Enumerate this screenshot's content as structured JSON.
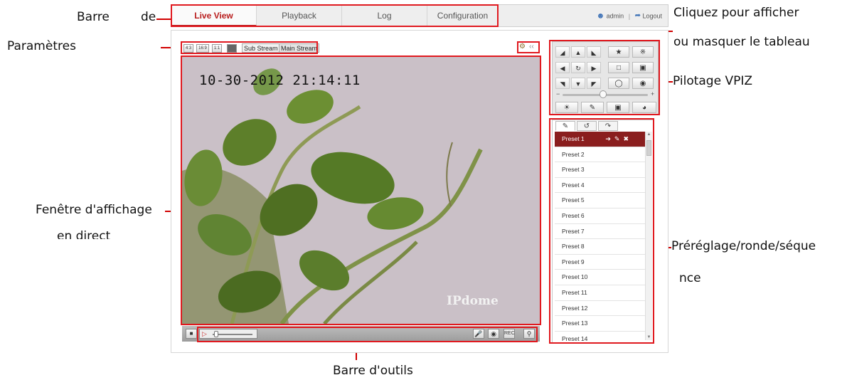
{
  "callouts": {
    "barre_de": [
      "Barre",
      "de"
    ],
    "parametres": "Paramètres",
    "toggle_panel": [
      "Cliquez pour afficher",
      "ou masquer le tableau"
    ],
    "ptz": "Pilotage VPIZ",
    "display_window": [
      "Fenêtre d'affichage",
      "en direct"
    ],
    "preset_patrol": [
      "Préréglage/ronde/séque",
      "nce"
    ],
    "toolbar": "Barre d'outils"
  },
  "nav": {
    "tabs": [
      "Live View",
      "Playback",
      "Log",
      "Configuration"
    ],
    "active_tab": "Live View",
    "user": "admin",
    "separator": "|",
    "logout": "Logout"
  },
  "stream_bar": {
    "ratio_buttons": [
      "4:3",
      "16:9",
      "1:1"
    ],
    "sub_stream": "Sub Stream",
    "main_stream": "Main Stream",
    "collapse": "‹‹"
  },
  "live_view": {
    "osd_datetime": "10-30-2012 21:14:11",
    "osd_brand": "IPdome"
  },
  "toolbar": {
    "icons": [
      "stop-icon",
      "volume-icon",
      "microphone-icon",
      "snapshot-icon",
      "record-icon",
      "zoom-icon"
    ],
    "volume_level": 0.1
  },
  "ptz": {
    "zoom_slider_minus": "−",
    "zoom_slider_plus": "+",
    "zoom_slider_level": 0.55
  },
  "presets": {
    "tabs": [
      "preset-tab",
      "patrol-tab",
      "pattern-tab"
    ],
    "items": [
      "Preset 1",
      "Preset 2",
      "Preset 3",
      "Preset 4",
      "Preset 5",
      "Preset 6",
      "Preset 7",
      "Preset 8",
      "Preset 9",
      "Preset 10",
      "Preset 11",
      "Preset 12",
      "Preset 13",
      "Preset 14"
    ],
    "selected": "Preset 1"
  },
  "colors": {
    "accent": "#b81c1c",
    "callout_line": "#e0191f",
    "selected_row": "#8a1e1e"
  }
}
